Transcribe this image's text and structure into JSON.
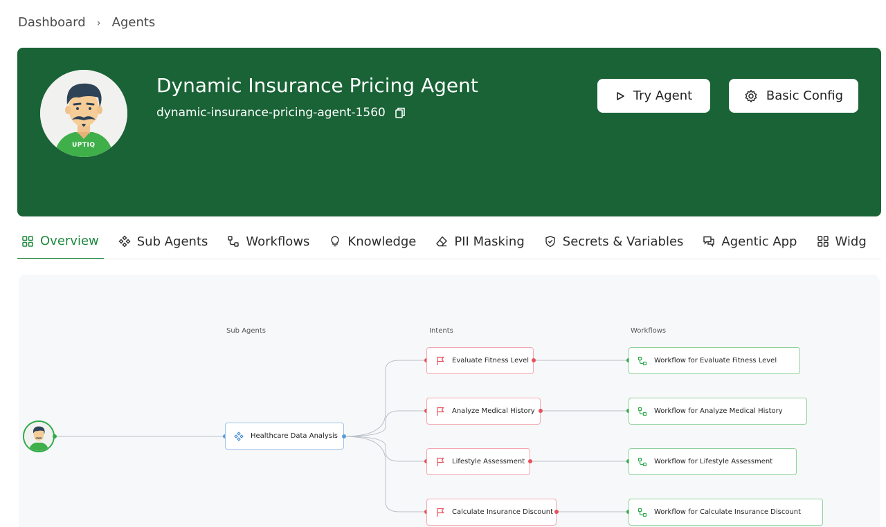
{
  "breadcrumb": {
    "home": "Dashboard",
    "separator": "›",
    "current": "Agents"
  },
  "agent": {
    "name": "Dynamic Insurance Pricing Agent",
    "slug": "dynamic-insurance-pricing-agent-1560",
    "avatar_badge": "UPTIQ"
  },
  "actions": {
    "try_label": "Try Agent",
    "config_label": "Basic Config"
  },
  "tabs": [
    {
      "label": "Overview",
      "icon": "grid-icon",
      "active": true
    },
    {
      "label": "Sub Agents",
      "icon": "diamond-cluster-icon"
    },
    {
      "label": "Workflows",
      "icon": "workflow-icon"
    },
    {
      "label": "Knowledge",
      "icon": "lightbulb-icon"
    },
    {
      "label": "PII Masking",
      "icon": "eraser-icon"
    },
    {
      "label": "Secrets & Variables",
      "icon": "shield-check-icon"
    },
    {
      "label": "Agentic App",
      "icon": "chat-icon"
    },
    {
      "label": "Widg",
      "icon": "widget-icon"
    }
  ],
  "graph": {
    "columns": {
      "sub_agents": "Sub Agents",
      "intents": "Intents",
      "workflows": "Workflows"
    },
    "sub_agent": "Healthcare Data Analysis",
    "intents": [
      "Evaluate Fitness Level",
      "Analyze Medical History",
      "Lifestyle Assessment",
      "Calculate Insurance Discount"
    ],
    "workflows": [
      "Workflow for Evaluate Fitness Level",
      "Workflow for Analyze Medical History",
      "Workflow for Lifestyle Assessment",
      "Workflow for Calculate Insurance Discount"
    ]
  },
  "colors": {
    "banner": "#196336",
    "accent": "#1e8a3f",
    "sub_agent_border": "#9ec2ea",
    "intent_border": "#f3a7b0",
    "workflow_border": "#8fd19c"
  }
}
